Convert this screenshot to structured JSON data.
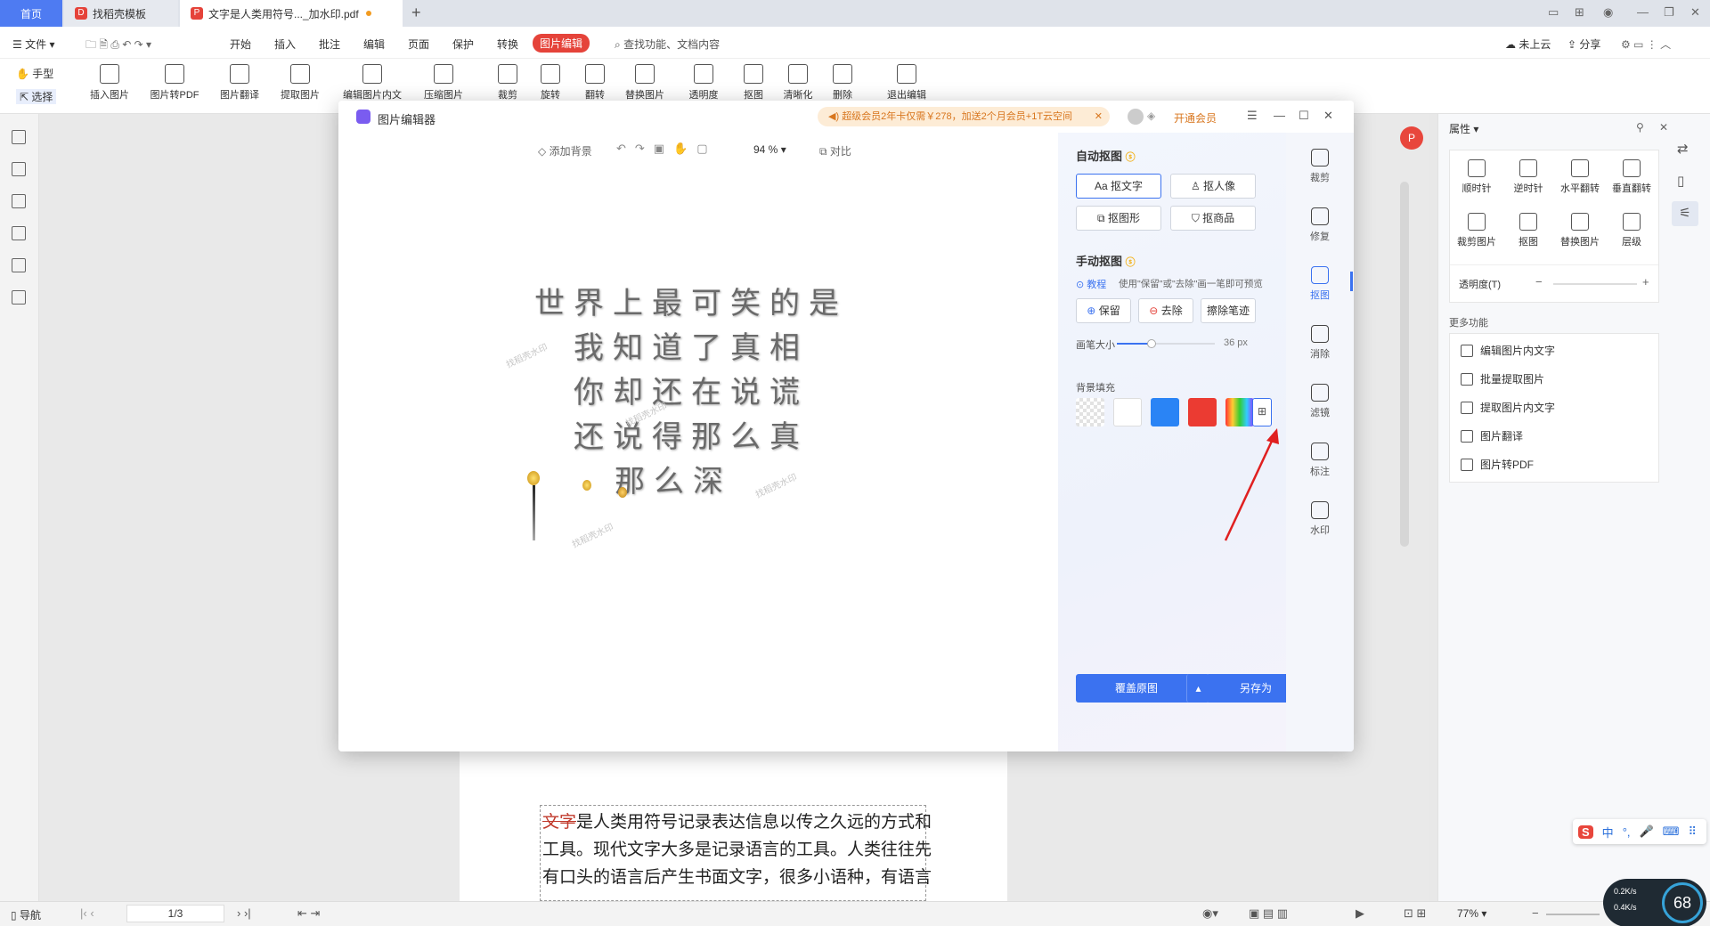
{
  "tabs": {
    "home": "首页",
    "template": "找稻壳模板",
    "document": "文字是人类用符号..._加水印.pdf"
  },
  "menubar": {
    "file": "文件",
    "items": [
      "开始",
      "插入",
      "批注",
      "编辑",
      "页面",
      "保护",
      "转换"
    ],
    "active": "图片编辑",
    "search": "查找功能、文档内容",
    "cloud": "未上云",
    "share": "分享"
  },
  "ribbon": {
    "hand": "手型",
    "select": "选择",
    "tools": [
      "插入图片",
      "图片转PDF",
      "图片翻译",
      "提取图片",
      "编辑图片内文字",
      "压缩图片",
      "裁剪",
      "旋转",
      "翻转",
      "替换图片",
      "透明度",
      "抠图",
      "清晰化",
      "删除",
      "退出编辑"
    ]
  },
  "dialog": {
    "title": "图片编辑器",
    "promo": "超级会员2年卡仅需￥278，加送2个月会员+1T云空间",
    "vip": "开通会员",
    "toolbar": {
      "add_bg": "添加背景",
      "zoom": "94 %",
      "compare": "对比"
    },
    "auto_cutout": {
      "title": "自动抠图",
      "text": "抠文字",
      "portrait": "抠人像",
      "shape": "抠图形",
      "product": "抠商品"
    },
    "manual_cutout": {
      "title": "手动抠图",
      "tutorial": "教程",
      "hint": "使用\"保留\"或\"去除\"画一笔即可预览",
      "keep": "保留",
      "remove": "去除",
      "erase": "擦除笔迹",
      "brush_label": "画笔大小",
      "brush_value": "36 px",
      "brush_level": 0.35
    },
    "bg_fill": {
      "title": "背景填充",
      "colors": [
        "#ffffff",
        "#2a84f5",
        "#eb3b32"
      ]
    },
    "rail": [
      "裁剪",
      "修复",
      "抠图",
      "消除",
      "滤镜",
      "标注",
      "水印"
    ],
    "overwrite": "覆盖原图",
    "save_as": "另存为",
    "image_text": [
      "世界上最可笑的是",
      "我知道了真相",
      "你却还在说谎",
      "还说得那么真",
      "那么深"
    ],
    "watermark": "找稻壳水印"
  },
  "properties": {
    "title": "属性",
    "tools": [
      "顺时针",
      "逆时针",
      "水平翻转",
      "垂直翻转",
      "裁剪图片",
      "抠图",
      "替换图片",
      "层级"
    ],
    "opacity_label": "透明度(T)",
    "more_title": "更多功能",
    "more": [
      "编辑图片内文字",
      "批量提取图片",
      "提取图片内文字",
      "图片翻译",
      "图片转PDF"
    ]
  },
  "document": {
    "lines": [
      {
        "strike": "文字",
        "rest": "是人类用符号记录表达信息以传之久远的方式和"
      },
      {
        "strike": "",
        "rest": "工具。现代文字大多是记录语言的工具。人类往往先"
      },
      {
        "strike": "",
        "rest": "有口头的语言后产生书面文字，很多小语种，有语言"
      }
    ]
  },
  "status": {
    "nav": "导航",
    "page": "1/3",
    "zoom": "77%",
    "net_up": "0.2",
    "net_down": "0.4",
    "net_unit": "K/s",
    "cpu": "68"
  },
  "ime": {
    "mode": "中"
  }
}
